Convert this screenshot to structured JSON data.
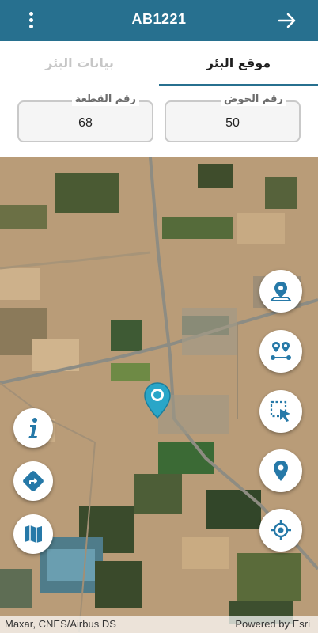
{
  "appbar": {
    "title": "AB1221",
    "menu_icon": "more-vertical-icon",
    "back_icon": "arrow-right-icon"
  },
  "tabs": [
    {
      "label": "بيانات البئر",
      "active": false
    },
    {
      "label": "موقع البئر",
      "active": true
    }
  ],
  "fields": {
    "basin": {
      "label": "رقم الحوض",
      "value": "50"
    },
    "parcel": {
      "label": "رقم القطعة",
      "value": "68"
    }
  },
  "map": {
    "attribution_left": "Maxar, CNES/Airbus DS",
    "attribution_right": "Powered by Esri",
    "right_buttons": [
      "pin-location-icon",
      "route-points-icon",
      "select-area-icon",
      "place-pin-icon",
      "my-location-icon"
    ],
    "left_buttons": [
      "info-icon",
      "directions-icon",
      "map-layers-icon"
    ],
    "marker_icon": "well-location-marker-icon"
  },
  "colors": {
    "primary": "#27708f",
    "icon_blue": "#2679a8",
    "marker": "#2aa6c8"
  }
}
